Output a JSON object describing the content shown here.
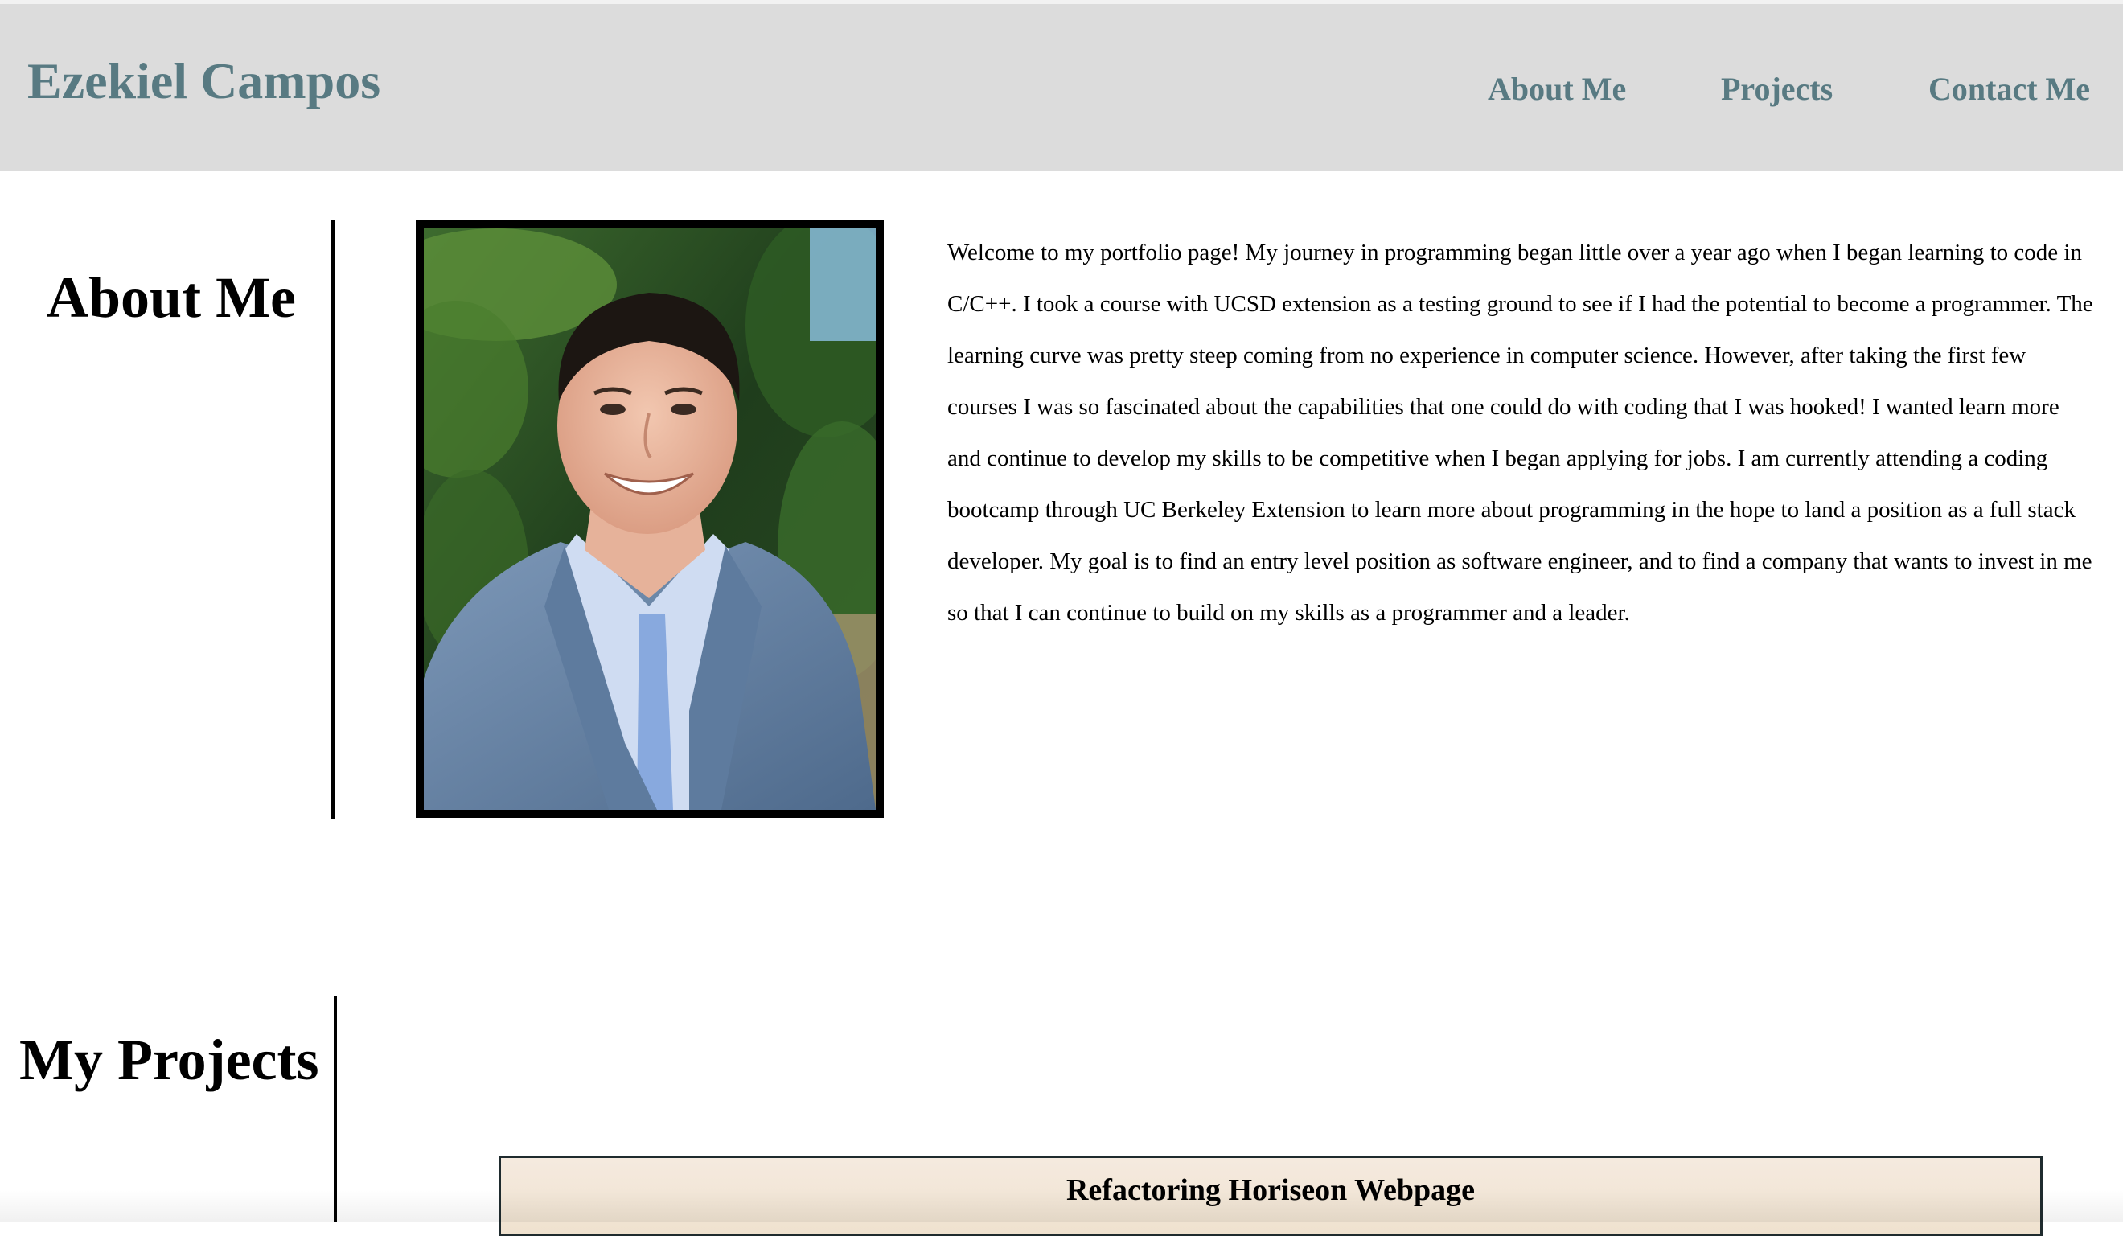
{
  "header": {
    "site_title": "Ezekiel Campos",
    "nav": [
      {
        "label": "About Me"
      },
      {
        "label": "Projects"
      },
      {
        "label": "Contact Me"
      }
    ]
  },
  "about": {
    "heading": "About Me",
    "text": "Welcome to my portfolio page! My journey in programming began little over a year ago when I began learning to code in C/C++. I took a course with UCSD extension as a testing ground to see if I had the potential to become a programmer. The learning curve was pretty steep coming from no experience in computer science. However, after taking the first few courses I was so fascinated about the capabilities that one could do with coding that I was hooked! I wanted learn more and continue to develop my skills to be competitive when I began applying for jobs. I am currently attending a coding bootcamp through UC Berkeley Extension to learn more about programming in the hope to land a position as a full stack developer. My goal is to find an entry level position as software engineer, and to find a company that wants to invest in me so that I can continue to build on my skills as a programmer and a leader."
  },
  "projects": {
    "heading": "My Projects",
    "items": [
      {
        "title": "Refactoring Horiseon Webpage"
      }
    ]
  },
  "colors": {
    "header_bg": "#dcdcdc",
    "brand_text": "#587a82",
    "card_bg": "#f3e7d8"
  }
}
